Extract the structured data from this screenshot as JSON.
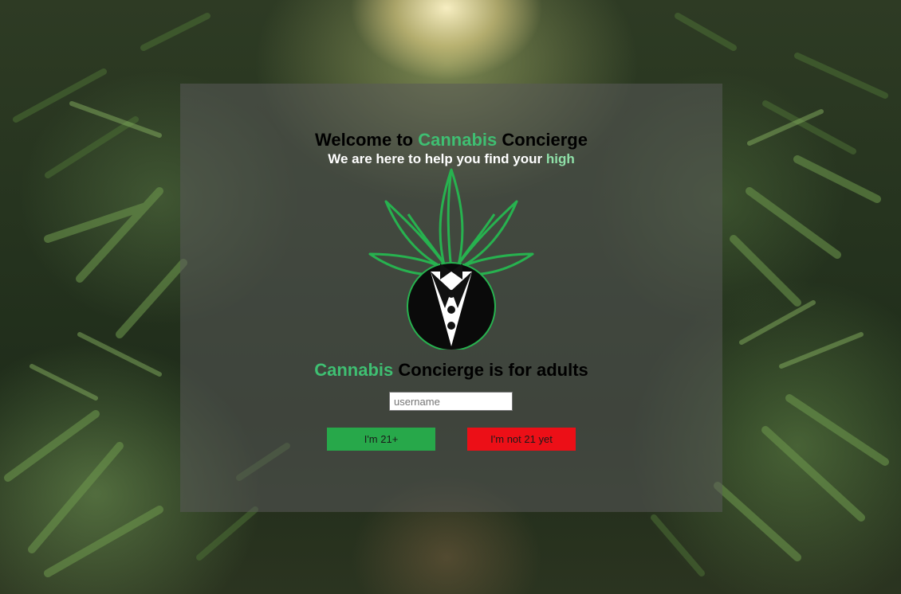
{
  "welcome": {
    "prefix": "Welcome to",
    "brand_green": "Cannabis",
    "brand_rest": "Concierge"
  },
  "tagline": {
    "text": "We are here to help you find your",
    "highlight": "high"
  },
  "logo": {
    "icon": "cannabis-leaf-tuxedo-logo"
  },
  "age_notice": {
    "brand_green": "Cannabis",
    "rest": "Concierge is for adults"
  },
  "form": {
    "username_placeholder": "username",
    "username_value": ""
  },
  "buttons": {
    "confirm_label": "I'm 21+",
    "deny_label": "I'm not 21 yet"
  },
  "colors": {
    "brand_green": "#3fbf72",
    "confirm_button": "#27a84a",
    "deny_button": "#ec0f17"
  }
}
